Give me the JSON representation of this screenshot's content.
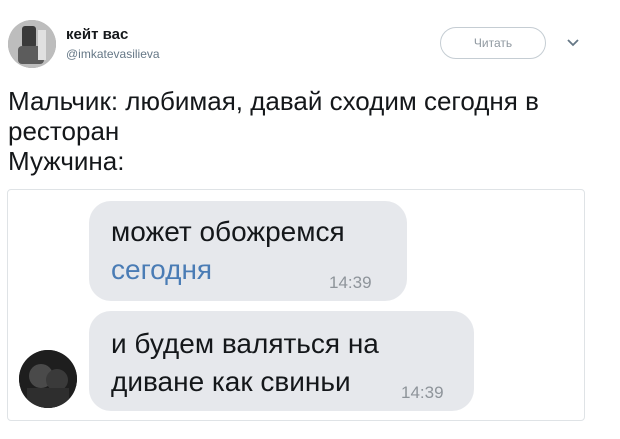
{
  "author": {
    "display_name": "кейт вас",
    "handle": "@imkatevasilieva",
    "avatar_icon": "profile-photo"
  },
  "actions": {
    "follow_label": "Читать",
    "menu_icon": "chevron-down-icon"
  },
  "tweet": {
    "lines": [
      "Мальчик: любимая, давай сходим сегодня в",
      "ресторан",
      "Мужчина:"
    ]
  },
  "chat": {
    "messages": [
      {
        "lines": [
          "может обожремся",
          "сегодня"
        ],
        "time": "14:39",
        "link_color": "#4a7cb5"
      },
      {
        "lines": [
          "и будем валяться на",
          "диване как свиньи"
        ],
        "time": "14:39"
      }
    ],
    "bubble_color": "#e6e8ec"
  }
}
